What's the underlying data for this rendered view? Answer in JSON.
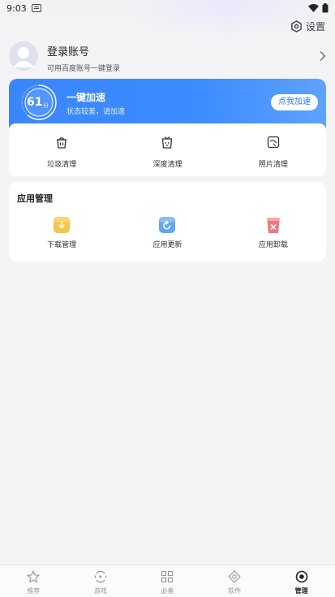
{
  "status_bar": {
    "time": "9:03"
  },
  "header": {
    "settings_label": "设置"
  },
  "account": {
    "name": "登录账号",
    "subtitle": "可用百度账号一键登录"
  },
  "boost": {
    "score": "61",
    "score_unit": "分",
    "score_fraction": 0.61,
    "title": "一键加速",
    "subtitle": "状态较差，请加速",
    "button_label": "点我加速"
  },
  "clean_tools": [
    {
      "label": "垃圾清理",
      "icon": "trash-icon"
    },
    {
      "label": "深度清理",
      "icon": "deep-clean-icon"
    },
    {
      "label": "照片清理",
      "icon": "photo-icon"
    }
  ],
  "apps": {
    "title": "应用管理",
    "items": [
      {
        "label": "下载管理",
        "icon": "download-icon",
        "color": "#f7c44a"
      },
      {
        "label": "应用更新",
        "icon": "update-icon",
        "color": "#5fa8f5"
      },
      {
        "label": "应用卸载",
        "icon": "uninstall-icon",
        "color": "#f0787c"
      }
    ]
  },
  "tabbar": {
    "items": [
      {
        "label": "推荐",
        "icon": "star-icon"
      },
      {
        "label": "游戏",
        "icon": "game-icon"
      },
      {
        "label": "必备",
        "icon": "grid-icon"
      },
      {
        "label": "软件",
        "icon": "software-icon"
      },
      {
        "label": "管理",
        "icon": "manage-icon",
        "active": true
      }
    ]
  },
  "colors": {
    "accent": "#3a86ff",
    "background": "#f4f4f6"
  }
}
